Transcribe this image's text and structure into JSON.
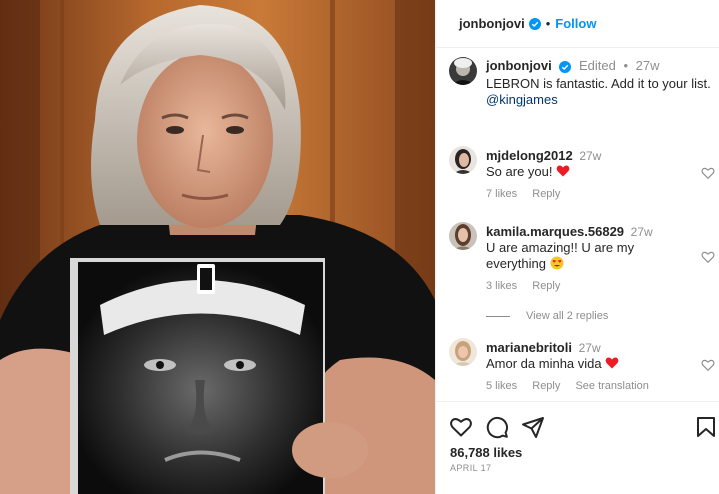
{
  "post": {
    "author": "jonbonjovi",
    "follow_label": "Follow",
    "separator": "•",
    "caption": {
      "username": "jonbonjovi",
      "edited_label": "Edited",
      "time": "27w",
      "text": "LEBRON is fantastic. Add it to your list.",
      "mention": "@kingjames"
    },
    "comments": [
      {
        "username": "mjdelong2012",
        "time": "27w",
        "text": "So are you!",
        "emoji": "red-heart",
        "likes": "7 likes",
        "reply_label": "Reply"
      },
      {
        "username": "kamila.marques.56829",
        "time": "27w",
        "text": "U are amazing!! U are my everything",
        "emoji": "heart-eyes",
        "likes": "3 likes",
        "reply_label": "Reply"
      },
      {
        "username": "marianebritoli",
        "time": "27w",
        "text": "Amor da minha vida",
        "emoji": "red-heart",
        "likes": "5 likes",
        "reply_label": "Reply",
        "translate_label": "See translation"
      }
    ],
    "view_replies_label": "View all 2 replies",
    "likes_count": "86,788 likes",
    "date": "APRIL 17",
    "icons": {
      "like": "heart-icon",
      "comment": "comment-icon",
      "share": "paper-plane-icon",
      "save": "bookmark-icon",
      "verified": "verified-badge-icon"
    },
    "colors": {
      "follow_blue": "#0095f6",
      "verified_blue": "#0095f6",
      "mention_blue": "#00376b",
      "text": "#262626",
      "muted": "#8e8e8e",
      "heart_red": "#ed1c24"
    }
  }
}
